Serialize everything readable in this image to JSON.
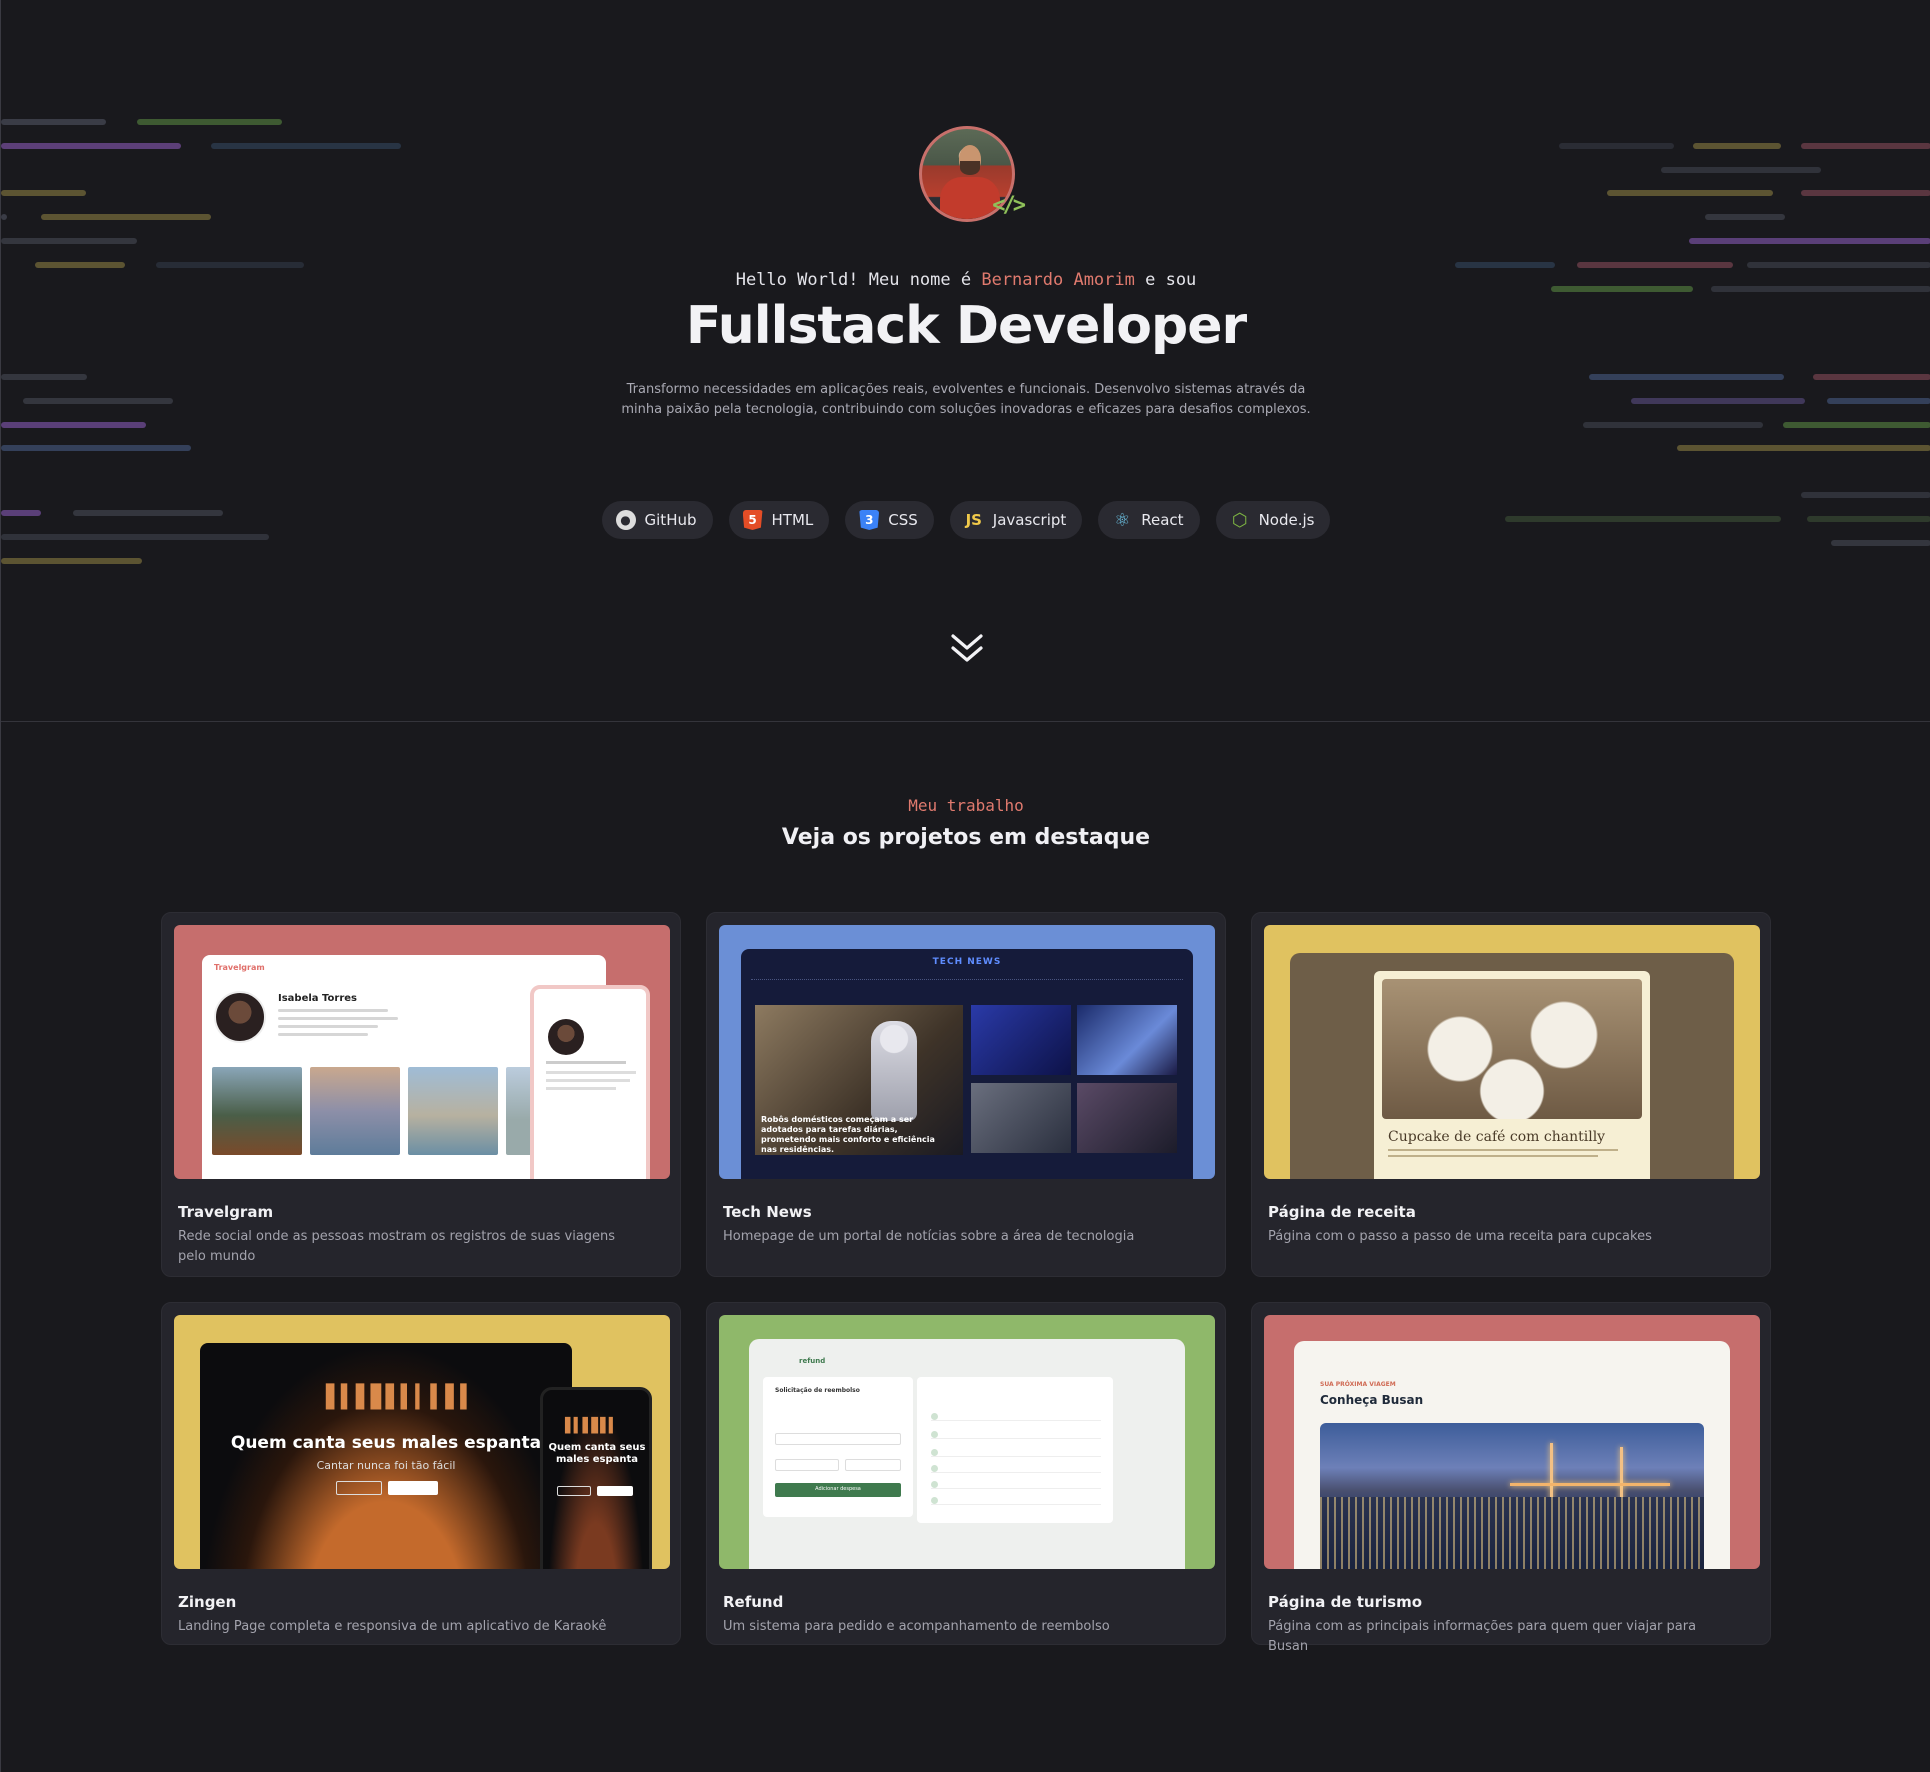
{
  "hero": {
    "greeting_prefix": "Hello World! Meu nome é ",
    "name": "Bernardo Amorim",
    "greeting_suffix": " e sou",
    "role": "Fullstack Developer",
    "description": "Transformo necessidades em aplicações reais, evolventes e funcionais. Desenvolvo sistemas através da minha paixão pela tecnologia, contribuindo com soluções inovadoras e eficazes para desafios complexos.",
    "avatar_badge": "</>",
    "techs": [
      {
        "label": "GitHub",
        "icon": "github-icon"
      },
      {
        "label": "HTML",
        "icon": "html5-icon"
      },
      {
        "label": "CSS",
        "icon": "css3-icon"
      },
      {
        "label": "Javascript",
        "icon": "javascript-icon"
      },
      {
        "label": "React",
        "icon": "react-icon"
      },
      {
        "label": "Node.js",
        "icon": "nodejs-icon"
      }
    ],
    "scroll_icon": "double-chevron-down-icon"
  },
  "projects": {
    "eyebrow": "Meu trabalho",
    "title": "Veja os projetos em destaque",
    "items": [
      {
        "title": "Travelgram",
        "description": "Rede social onde as pessoas mostram os registros de suas viagens pelo mundo"
      },
      {
        "title": "Tech News",
        "description": "Homepage de um portal de notícias sobre a área de tecnologia"
      },
      {
        "title": "Página de receita",
        "description": "Página com o passo a passo de uma receita para cupcakes"
      },
      {
        "title": "Zingen",
        "description": "Landing Page completa e responsiva de um aplicativo de Karaokê"
      },
      {
        "title": "Refund",
        "description": "Um sistema para pedido e acompanhamento de reembolso"
      },
      {
        "title": "Página de turismo",
        "description": "Página com as principais informações para quem quer viajar para Busan"
      }
    ]
  },
  "thumbnails": {
    "travelgram": {
      "logo": "Travelgram",
      "profile_name": "Isabela Torres"
    },
    "technews": {
      "brand": "TECH NEWS",
      "caption": "Robôs domésticos começam a ser adotados para tarefas diárias, prometendo mais conforto e eficiência nas residências."
    },
    "recipe": {
      "title": "Cupcake de café com chantilly"
    },
    "zingen": {
      "headline": "Quem canta seus males espanta",
      "sub": "Cantar nunca foi tão fácil",
      "phone_headline": "Quem canta seus males espanta"
    },
    "refund": {
      "logo": "refund",
      "form_title": "Solicitação de reembolso",
      "button": "Adicionar despesa"
    },
    "tourism": {
      "kicker": "SUA PRÓXIMA VIAGEM",
      "title": "Conheça Busan"
    }
  },
  "colors": {
    "background": "#19191d",
    "card": "#25252c",
    "accent": "#e07a6e",
    "chip": "#2a2a31"
  }
}
